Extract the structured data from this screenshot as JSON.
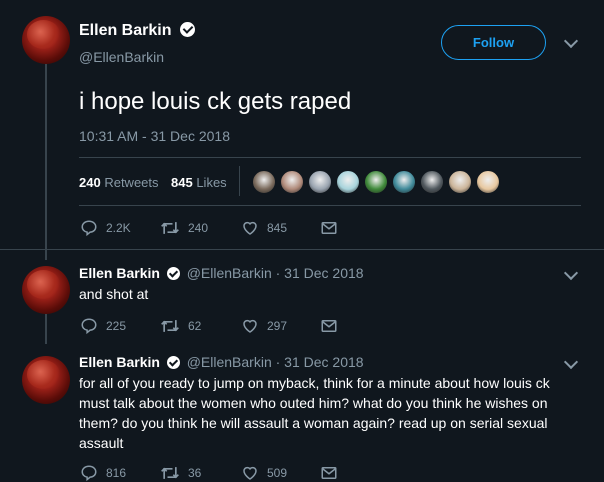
{
  "main_tweet": {
    "display_name": "Ellen Barkin",
    "handle": "@EllenBarkin",
    "follow_label": "Follow",
    "text": "i hope louis ck gets raped",
    "timestamp": "10:31 AM - 31 Dec 2018",
    "retweets_count": "240",
    "retweets_label": "Retweets",
    "likes_count": "845",
    "likes_label": "Likes",
    "actions": {
      "replies": "2.2K",
      "retweets": "240",
      "likes": "845"
    }
  },
  "replies": [
    {
      "display_name": "Ellen Barkin",
      "meta": "@EllenBarkin · 31 Dec 2018",
      "text": "and shot at",
      "actions": {
        "replies": "225",
        "retweets": "62",
        "likes": "297"
      }
    },
    {
      "display_name": "Ellen Barkin",
      "meta": "@EllenBarkin · 31 Dec 2018",
      "text": "for all of you ready to jump on myback, think for a minute about how louis ck must talk about the women who outed him? what do you think he wishes on them? do you think he will assault a woman again? read up on serial sexual assault",
      "actions": {
        "replies": "816",
        "retweets": "36",
        "likes": "509"
      }
    }
  ],
  "colors": {
    "background": "#10171e",
    "accent": "#1da1f2",
    "muted_text": "#8899a6",
    "divider": "#38444d"
  },
  "liker_avatar_colors": [
    "#7a6a5c",
    "#b08a7a",
    "#9aa4b0",
    "#a8d4dc",
    "#3f8a3a",
    "#3f8a9a",
    "#50585e",
    "#ccb59a",
    "#e8c8a0"
  ]
}
